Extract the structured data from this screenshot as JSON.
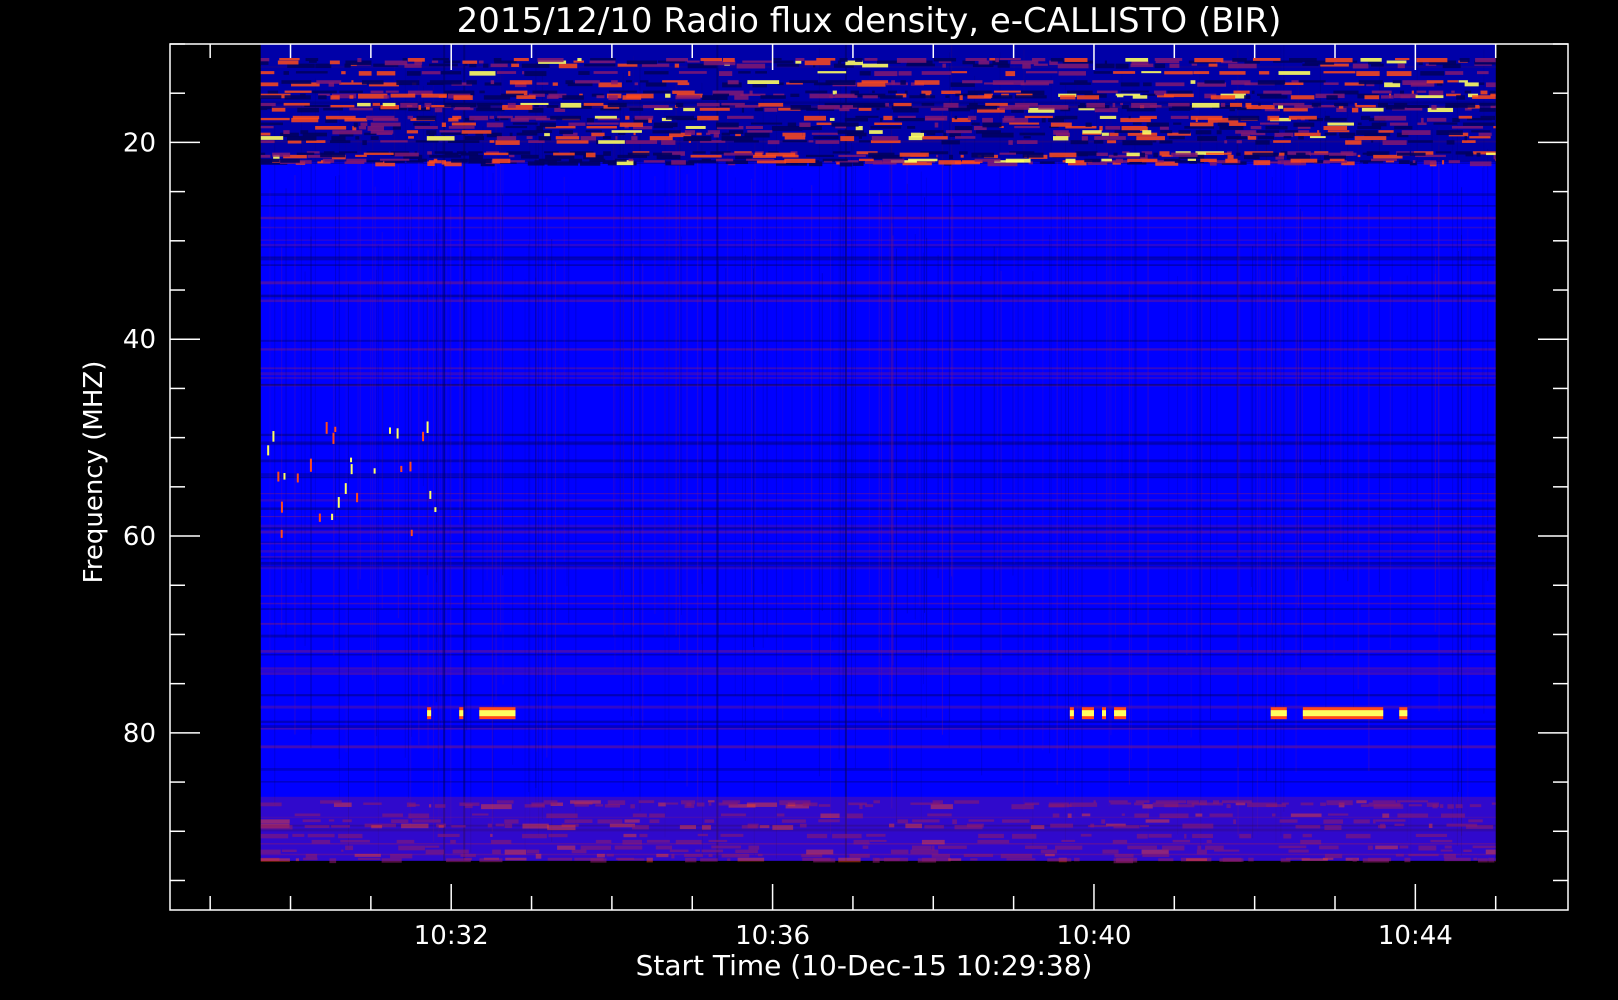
{
  "chart_data": {
    "type": "heatmap",
    "title": "2015/12/10  Radio flux density, e-CALLISTO (BIR)",
    "xlabel": "Start Time (10-Dec-15 10:29:38)",
    "ylabel": "Frequency (MHZ)",
    "x_major_ticks": [
      {
        "minutes": 32,
        "label": "10:32"
      },
      {
        "minutes": 36,
        "label": "10:36"
      },
      {
        "minutes": 40,
        "label": "10:40"
      },
      {
        "minutes": 44,
        "label": "10:44"
      }
    ],
    "y_major_ticks": [
      {
        "value": 20,
        "label": "20"
      },
      {
        "value": 40,
        "label": "40"
      },
      {
        "value": 60,
        "label": "60"
      },
      {
        "value": 80,
        "label": "80"
      }
    ],
    "x_minor_step_minutes": 1,
    "y_minor_step": 5,
    "xlim_minutes": [
      28.5,
      45.9
    ],
    "ylim": [
      10,
      98
    ],
    "data_extent": {
      "x_minutes": [
        29.63,
        45.0
      ],
      "y": [
        10,
        93
      ]
    },
    "colors": {
      "background": "#0000ff",
      "dark": "#000060",
      "mid": "#8a1a6e",
      "bright": "#ff4a1a",
      "peak": "#ffff60",
      "axis": "#ffffff"
    },
    "features": [
      {
        "kind": "rfi_band",
        "y_range": [
          10,
          22
        ],
        "x_range": [
          29.63,
          45.0
        ],
        "intensity": "high"
      },
      {
        "kind": "rfi_band",
        "y_range": [
          86.5,
          93
        ],
        "x_range": [
          29.63,
          45.0
        ],
        "intensity": "medium"
      },
      {
        "kind": "narrowband_line",
        "y": 78,
        "x_ranges": [
          [
            31.7,
            31.75
          ],
          [
            32.1,
            32.15
          ],
          [
            32.35,
            32.8
          ],
          [
            39.7,
            39.75
          ],
          [
            39.85,
            40.0
          ],
          [
            40.1,
            40.15
          ],
          [
            40.25,
            40.4
          ],
          [
            42.2,
            42.4
          ],
          [
            42.6,
            43.6
          ],
          [
            43.8,
            43.9
          ]
        ]
      },
      {
        "kind": "impulsive_spikes",
        "y_range": [
          48,
          60
        ],
        "x_range": [
          29.63,
          32.0
        ]
      }
    ]
  }
}
